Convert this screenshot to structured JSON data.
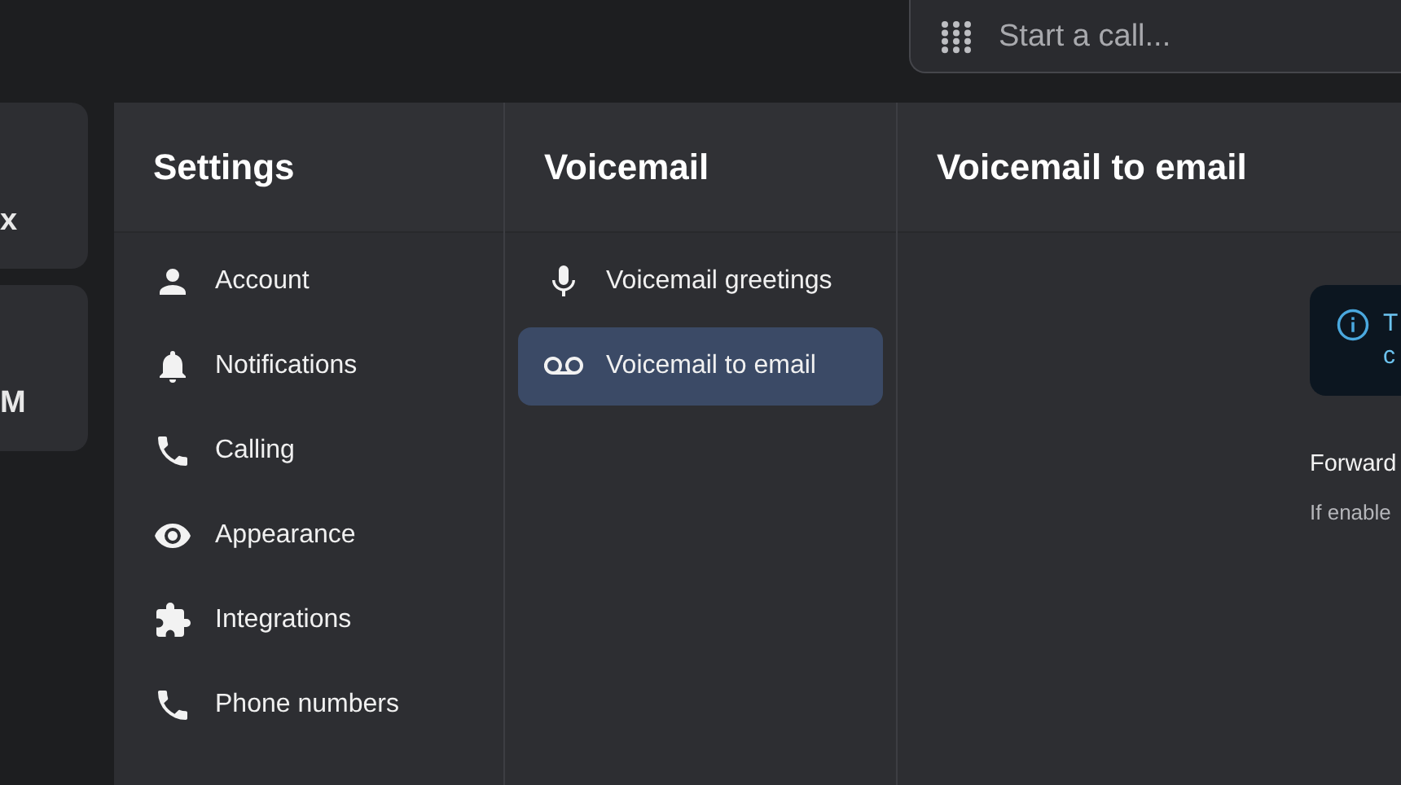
{
  "search": {
    "placeholder": "Start a call..."
  },
  "side_cards": [
    "x",
    "M"
  ],
  "settings": {
    "title": "Settings",
    "items": [
      {
        "label": "Account",
        "selected": false
      },
      {
        "label": "Notifications",
        "selected": false
      },
      {
        "label": "Calling",
        "selected": false
      },
      {
        "label": "Appearance",
        "selected": false
      },
      {
        "label": "Integrations",
        "selected": false
      },
      {
        "label": "Phone numbers",
        "selected": false
      }
    ]
  },
  "voicemail": {
    "title": "Voicemail",
    "items": [
      {
        "label": "Voicemail greetings",
        "selected": false
      },
      {
        "label": "Voicemail to email",
        "selected": true
      }
    ]
  },
  "detail": {
    "title": "Voicemail to email",
    "banner_lines": [
      "T",
      "c"
    ],
    "heading": "Forward",
    "description": "If enable"
  }
}
